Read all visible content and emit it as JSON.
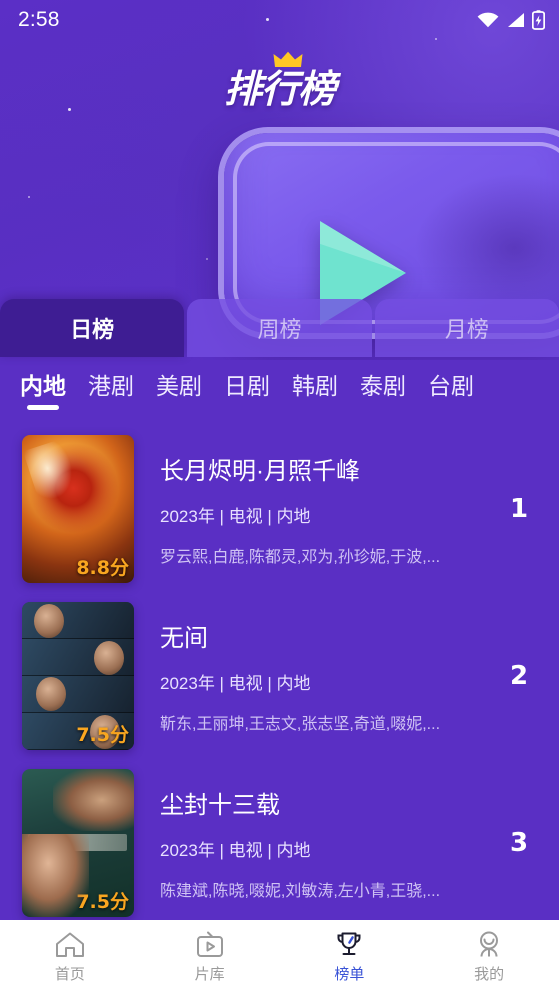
{
  "status_bar": {
    "time": "2:58",
    "icons": [
      "wifi-icon",
      "signal-icon",
      "battery-charging-icon"
    ]
  },
  "header": {
    "logo_text": "排行榜",
    "crown_icon": "crown-icon",
    "play_icon": "play-triangle-icon",
    "colors": {
      "background": "#5a2fc4",
      "card": "#7b5bec",
      "play": "#6fe3cf",
      "active_tab": "#3e1d93",
      "accent_rating": "#f9a620",
      "nav_active": "#3a53d6"
    }
  },
  "period_tabs": [
    {
      "label": "日榜",
      "active": true
    },
    {
      "label": "周榜",
      "active": false
    },
    {
      "label": "月榜",
      "active": false
    }
  ],
  "categories": [
    {
      "label": "内地",
      "active": true
    },
    {
      "label": "港剧",
      "active": false
    },
    {
      "label": "美剧",
      "active": false
    },
    {
      "label": "日剧",
      "active": false
    },
    {
      "label": "韩剧",
      "active": false
    },
    {
      "label": "泰剧",
      "active": false
    },
    {
      "label": "台剧",
      "active": false
    }
  ],
  "list": [
    {
      "rank": "1",
      "title": "长月烬明·月照千峰",
      "meta": "2023年 | 电视 | 内地",
      "cast": "罗云熙,白鹿,陈都灵,邓为,孙珍妮,于波,...",
      "rating": "8.8分"
    },
    {
      "rank": "2",
      "title": "无间",
      "meta": "2023年 | 电视 | 内地",
      "cast": "靳东,王丽坤,王志文,张志坚,奇道,啜妮,...",
      "rating": "7.5分"
    },
    {
      "rank": "3",
      "title": "尘封十三载",
      "meta": "2023年 | 电视 | 内地",
      "cast": "陈建斌,陈晓,啜妮,刘敏涛,左小青,王骁,...",
      "rating": "7.5分"
    }
  ],
  "bottom_nav": [
    {
      "label": "首页",
      "icon": "home-icon",
      "active": false
    },
    {
      "label": "片库",
      "icon": "tv-icon",
      "active": false
    },
    {
      "label": "榜单",
      "icon": "trophy-icon",
      "active": true
    },
    {
      "label": "我的",
      "icon": "person-icon",
      "active": false
    }
  ]
}
